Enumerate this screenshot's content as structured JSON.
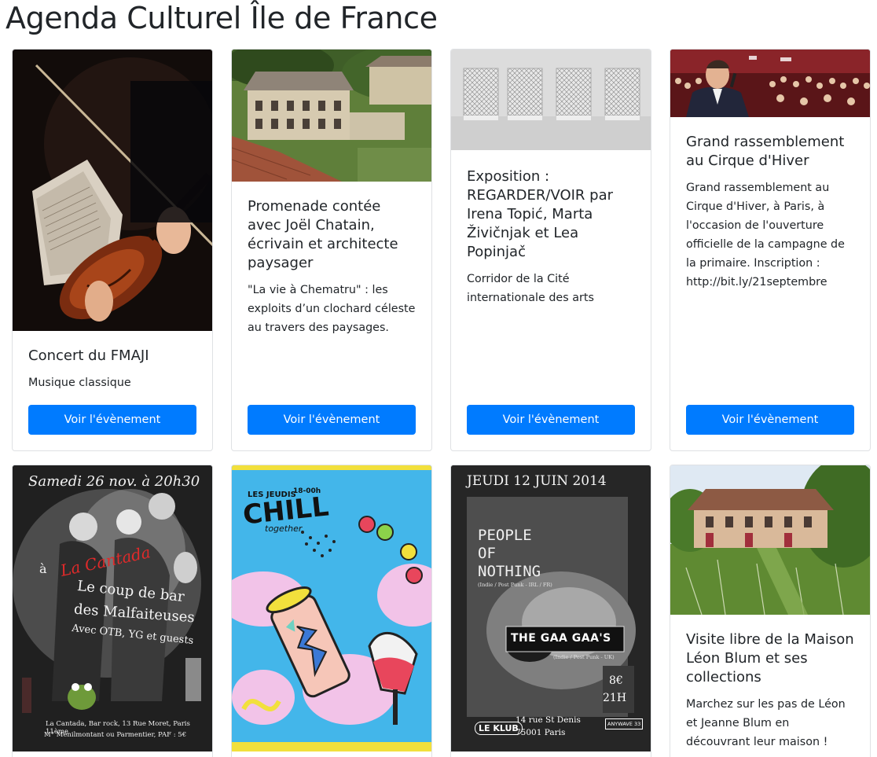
{
  "page": {
    "title": "Agenda Culturel Île de France"
  },
  "cards": [
    {
      "title": "Concert du FMAJI",
      "description": "Musique classique",
      "button": "Voir l'évènement"
    },
    {
      "title": "Promenade contée avec Joël Chatain, écrivain et architecte paysager",
      "description": "\"La vie à Chematru\" : les exploits d’un clochard céleste au travers des paysages.",
      "button": "Voir l'évènement"
    },
    {
      "title": "Exposition : REGARDER/VOIR par Irena Topić, Marta Živičnjak et Lea Popinjač",
      "description": "Corridor de la Cité internationale des arts",
      "button": "Voir l'évènement"
    },
    {
      "title": "Grand rassemblement au Cirque d'Hiver",
      "description": "Grand rassemblement au Cirque d'Hiver, à Paris, à l'occasion de l'ouverture officielle de la campagne de la primaire. Inscription : http://bit.ly/21septembre",
      "button": "Voir l'évènement"
    },
    {
      "title": "",
      "description": ""
    },
    {
      "title": "",
      "description": ""
    },
    {
      "title": "",
      "description": ""
    },
    {
      "title": "Visite libre de la Maison Léon Blum et ses collections",
      "description": "Marchez sur les pas de Léon et Jeanne Blum en découvrant leur maison !"
    }
  ],
  "posters": {
    "cantada": {
      "date": "Samedi 26 nov. à 20h30",
      "a": "à",
      "venue": "La Cantada",
      "line1": "Le coup de bar",
      "line2": "des Malfaiteuses",
      "line3": "Avec OTB, YG et guests",
      "address": "La Cantada, Bar rock, 13 Rue Moret, Paris 11ème",
      "metro": "M° Ménilmontant ou Parmentier, PAF : 5€"
    },
    "chill": {
      "top": "LES JEUDIS",
      "time": "18-00h",
      "main": "CHILL",
      "sub": "together"
    },
    "people": {
      "date": "JEUDI 12 JUIN 2014",
      "band1a": "PEOPLE",
      "band1b": "OF",
      "band1c": "NOTHING",
      "band1genre": "(Indie / Post Punk - IRL / FR)",
      "band2": "THE GAA GAA'S",
      "band2genre": "(Indie / Post Punk - UK)",
      "price": "8€",
      "time": "21H",
      "venue": "LE KLUB",
      "address1": "14 rue St Denis",
      "address2": "75001 Paris",
      "sponsor": "ANYWAVE 33"
    }
  }
}
